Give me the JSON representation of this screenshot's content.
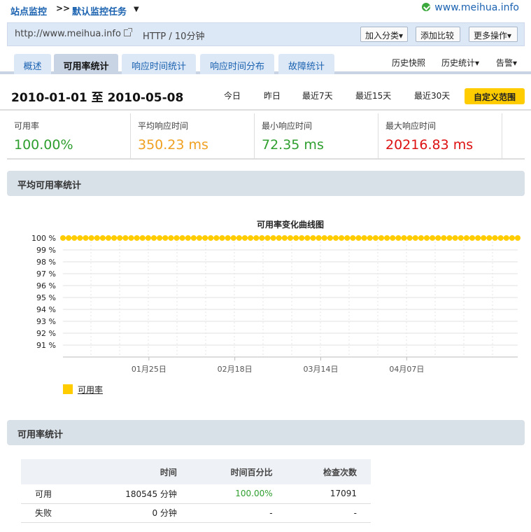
{
  "breadcrumb": {
    "site": "站点监控",
    "separator": ">>",
    "task": "默认监控任务",
    "task_arrow": "▼"
  },
  "site_status": {
    "domain": "www.meihua.info",
    "status_color": "#3aa83a"
  },
  "url_bar": {
    "url": "http://www.meihua.info",
    "external_icon": "external-link-icon",
    "protocol_interval": "HTTP / 10分钟",
    "buttons": {
      "add_category": "加入分类▾",
      "add_compare": "添加比较",
      "more_actions": "更多操作▾"
    }
  },
  "tabs": [
    {
      "label": "概述",
      "active": false
    },
    {
      "label": "可用率统计",
      "active": true
    },
    {
      "label": "响应时间统计",
      "active": false
    },
    {
      "label": "响应时间分布",
      "active": false
    },
    {
      "label": "故障统计",
      "active": false
    }
  ],
  "right_links": [
    "历史快照",
    "历史统计▾",
    "告警▾"
  ],
  "date_filter": {
    "range": "2010-01-01 至 2010-05-08",
    "quick": [
      "今日",
      "昨日",
      "最近7天",
      "最近15天",
      "最近30天"
    ],
    "custom": "自定义范围",
    "custom_color": "#ffcc00"
  },
  "metrics": [
    {
      "label": "可用率",
      "value": "100.00%",
      "color": "#2e9e2e"
    },
    {
      "label": "平均响应时间",
      "value": "350.23 ms",
      "color": "#f0a020"
    },
    {
      "label": "最小响应时间",
      "value": "72.35 ms",
      "color": "#2e9e2e"
    },
    {
      "label": "最大响应时间",
      "value": "20216.83 ms",
      "color": "#dd1111"
    }
  ],
  "sections": {
    "avg_availability": "平均可用率统计",
    "availability_stats": "可用率统计"
  },
  "chart_data": {
    "type": "line",
    "title": "可用率变化曲线图",
    "y_ticks": [
      "100 %",
      "99 %",
      "98 %",
      "97 %",
      "96 %",
      "95 %",
      "94 %",
      "93 %",
      "92 %",
      "91 %"
    ],
    "ylim": [
      90,
      100
    ],
    "x_ticks": [
      "01月25日",
      "02月18日",
      "03月14日",
      "04月07日"
    ],
    "x_range": [
      "2010-01-01",
      "2010-05-08"
    ],
    "grid": true,
    "legend_position": "bottom-left",
    "series": [
      {
        "name": "可用率",
        "color": "#ffcc00",
        "constant_value": 100
      }
    ]
  },
  "stats_table": {
    "headers": [
      "",
      "时间",
      "时间百分比",
      "检查次数"
    ],
    "rows": [
      {
        "label": "可用",
        "time": "180545 分钟",
        "percent": "100.00%",
        "checks": "17091"
      },
      {
        "label": "失败",
        "time": "0 分钟",
        "percent": "-",
        "checks": "-"
      }
    ]
  }
}
